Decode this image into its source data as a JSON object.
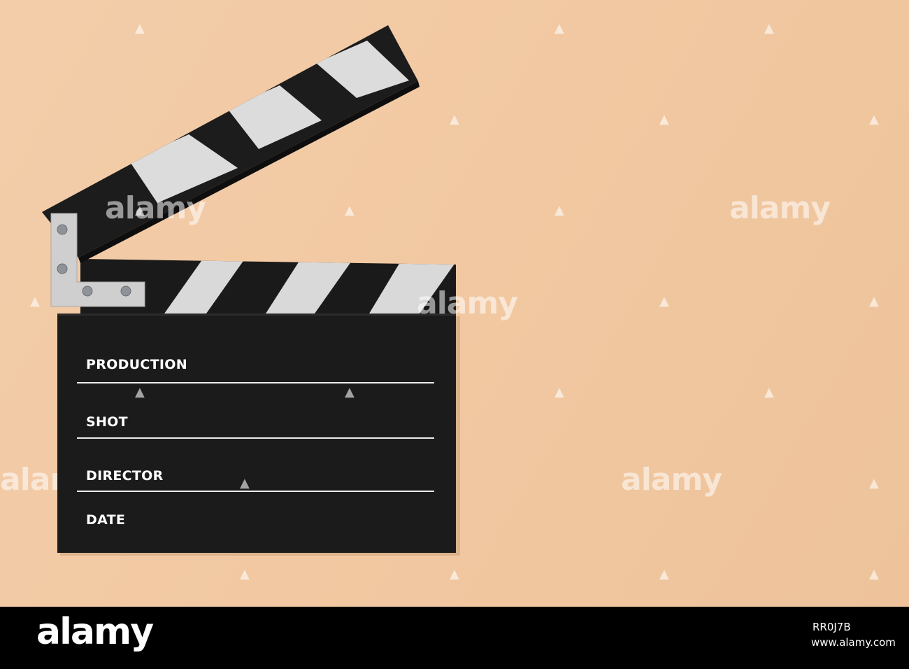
{
  "slate": {
    "fields": [
      "PRODUCTION",
      "SHOT",
      "DIRECTOR",
      "DATE"
    ]
  },
  "watermarks": {
    "brand": "alamy"
  },
  "footer": {
    "logo": "alamy",
    "image_id": "RR0J7B",
    "url": "www.alamy.com"
  },
  "colors": {
    "background": "#f1c9a3",
    "slate": "#1c1c1c",
    "stripe": "#dcdcdc",
    "footer": "#000000"
  }
}
